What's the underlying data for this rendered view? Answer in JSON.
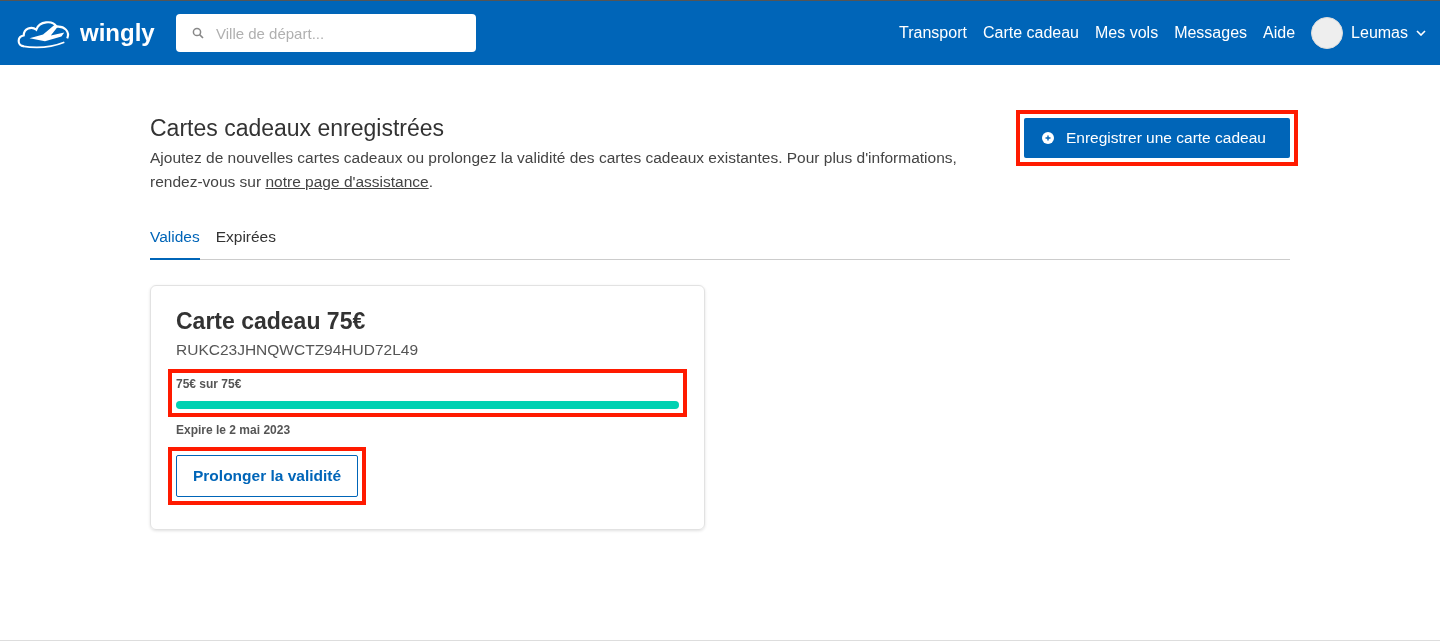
{
  "header": {
    "brand": "wingly",
    "search": {
      "placeholder": "Ville de départ..."
    },
    "nav": [
      "Transport",
      "Carte cadeau",
      "Mes vols",
      "Messages",
      "Aide"
    ],
    "user": {
      "name": "Leumas"
    }
  },
  "page": {
    "title": "Cartes cadeaux enregistrées",
    "description_before": "Ajoutez de nouvelles cartes cadeaux ou prolongez la validité des cartes cadeaux existantes. Pour plus d'informations, rendez-vous sur ",
    "description_link": "notre page d'assistance",
    "description_after": ".",
    "register_button": {
      "label": "Enregistrer une carte cadeau",
      "highlighted": true
    }
  },
  "tabs": [
    {
      "label": "Valides",
      "selected": true
    },
    {
      "label": "Expirées",
      "selected": false
    }
  ],
  "cards": [
    {
      "title": "Carte cadeau 75€",
      "code": "RUKC23JHNQWCTZ94HUD72L49",
      "balance": "75€ sur 75€",
      "level": 1,
      "balance_highlighted": true,
      "expiry": "Expire le 2 mai 2023",
      "button": {
        "label": "Prolonger la validité",
        "highlighted": true
      }
    }
  ]
}
